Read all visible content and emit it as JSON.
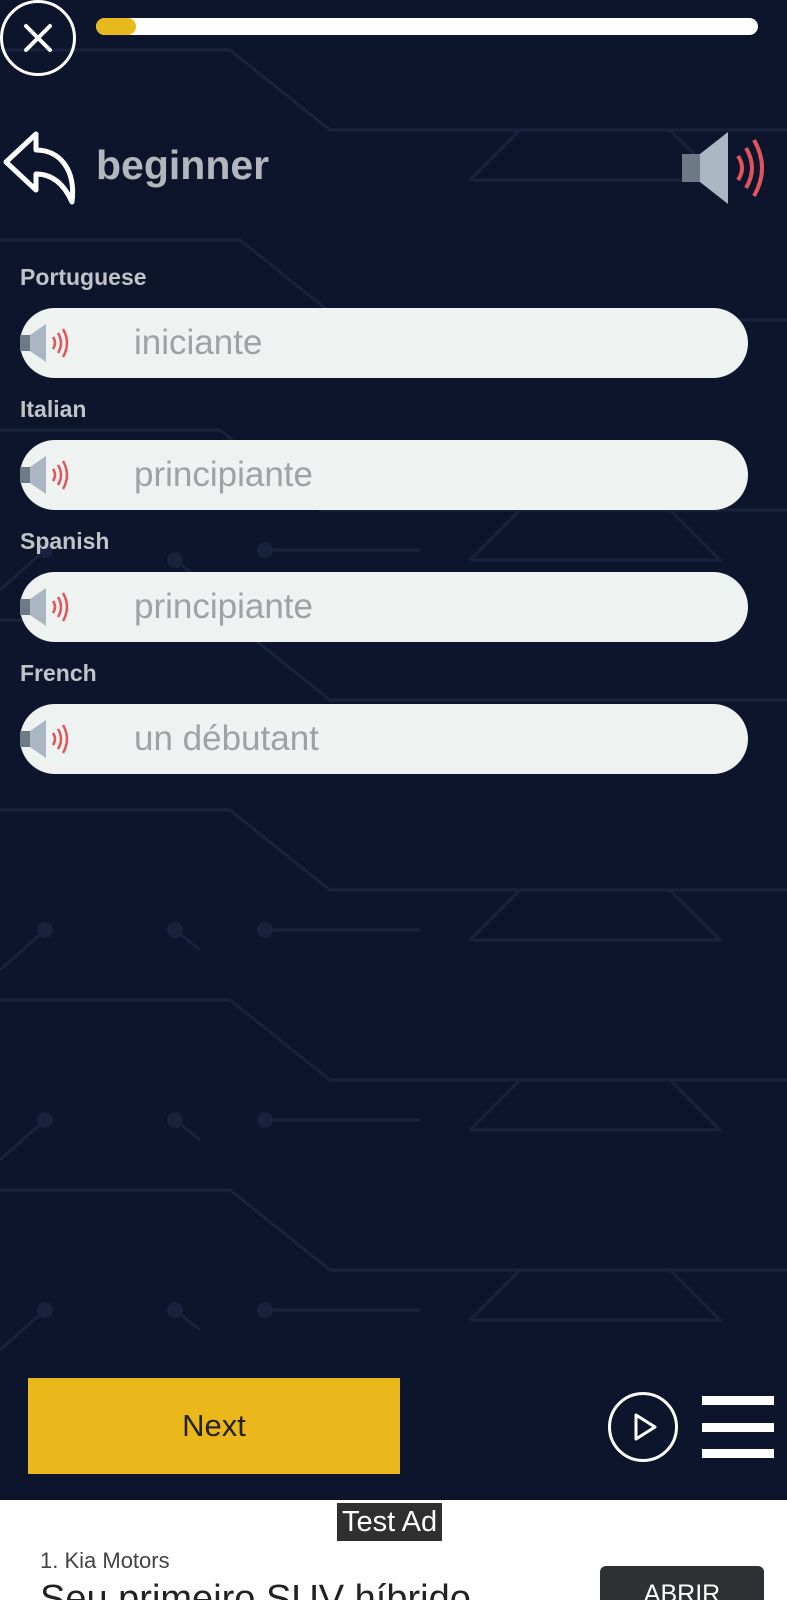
{
  "header": {
    "word": "beginner",
    "progress_percent": 6
  },
  "translations": [
    {
      "language": "Portuguese",
      "text": "iniciante"
    },
    {
      "language": "Italian",
      "text": "principiante"
    },
    {
      "language": "Spanish",
      "text": "principiante"
    },
    {
      "language": "French",
      "text": "un débutant"
    }
  ],
  "controls": {
    "next_label": "Next"
  },
  "ad": {
    "tag": "Test Ad",
    "sponsor": "1. Kia Motors",
    "headline": "Seu primeiro SUV híbrido",
    "cta": "ABRIR"
  },
  "colors": {
    "background": "#0d152c",
    "accent": "#ebb81b",
    "pill": "#eef2f1",
    "speaker_waves": "#e0555c"
  },
  "icons": [
    "close-icon",
    "back-arrow-icon",
    "speaker-icon",
    "play-icon",
    "menu-icon"
  ]
}
